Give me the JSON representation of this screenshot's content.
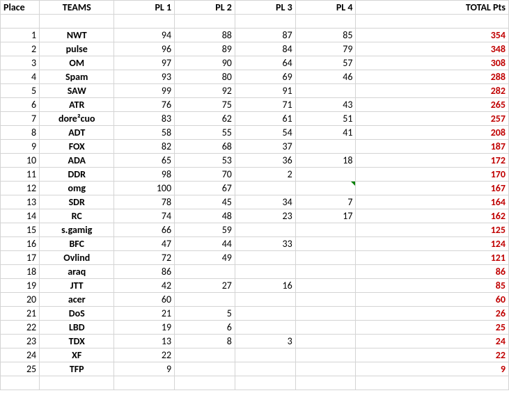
{
  "headers": {
    "place": "Place",
    "teams": "TEAMS",
    "pl1": "PL 1",
    "pl2": "PL 2",
    "pl3": "PL 3",
    "pl4": "PL 4",
    "total": "TOTAL Pts"
  },
  "rows": [
    {
      "place": "1",
      "team": "NWT",
      "pl1": "94",
      "pl2": "88",
      "pl3": "87",
      "pl4": "85",
      "total": "354"
    },
    {
      "place": "2",
      "team": "pulse",
      "pl1": "96",
      "pl2": "89",
      "pl3": "84",
      "pl4": "79",
      "total": "348"
    },
    {
      "place": "3",
      "team": "OM",
      "pl1": "97",
      "pl2": "90",
      "pl3": "64",
      "pl4": "57",
      "total": "308"
    },
    {
      "place": "4",
      "team": "Spam",
      "pl1": "93",
      "pl2": "80",
      "pl3": "69",
      "pl4": "46",
      "total": "288"
    },
    {
      "place": "5",
      "team": "SAW",
      "pl1": "99",
      "pl2": "92",
      "pl3": "91",
      "pl4": "",
      "total": "282"
    },
    {
      "place": "6",
      "team": "ATR",
      "pl1": "76",
      "pl2": "75",
      "pl3": "71",
      "pl4": "43",
      "total": "265"
    },
    {
      "place": "7",
      "team": "dore²cuo",
      "pl1": "83",
      "pl2": "62",
      "pl3": "61",
      "pl4": "51",
      "total": "257"
    },
    {
      "place": "8",
      "team": "ADT",
      "pl1": "58",
      "pl2": "55",
      "pl3": "54",
      "pl4": "41",
      "total": "208"
    },
    {
      "place": "9",
      "team": "FOX",
      "pl1": "82",
      "pl2": "68",
      "pl3": "37",
      "pl4": "",
      "total": "187"
    },
    {
      "place": "10",
      "team": "ADA",
      "pl1": "65",
      "pl2": "53",
      "pl3": "36",
      "pl4": "18",
      "total": "172"
    },
    {
      "place": "11",
      "team": "DDR",
      "pl1": "98",
      "pl2": "70",
      "pl3": "2",
      "pl4": "",
      "total": "170"
    },
    {
      "place": "12",
      "team": "omg",
      "pl1": "100",
      "pl2": "67",
      "pl3": "",
      "pl4": "",
      "total": "167",
      "pl4_flag": true
    },
    {
      "place": "13",
      "team": "SDR",
      "pl1": "78",
      "pl2": "45",
      "pl3": "34",
      "pl4": "7",
      "total": "164"
    },
    {
      "place": "14",
      "team": "RC",
      "pl1": "74",
      "pl2": "48",
      "pl3": "23",
      "pl4": "17",
      "total": "162"
    },
    {
      "place": "15",
      "team": "s.gamig",
      "pl1": "66",
      "pl2": "59",
      "pl3": "",
      "pl4": "",
      "total": "125"
    },
    {
      "place": "16",
      "team": "BFC",
      "pl1": "47",
      "pl2": "44",
      "pl3": "33",
      "pl4": "",
      "total": "124"
    },
    {
      "place": "17",
      "team": "Ovlind",
      "pl1": "72",
      "pl2": "49",
      "pl3": "",
      "pl4": "",
      "total": "121"
    },
    {
      "place": "18",
      "team": "araq",
      "pl1": "86",
      "pl2": "",
      "pl3": "",
      "pl4": "",
      "total": "86"
    },
    {
      "place": "19",
      "team": "JTT",
      "pl1": "42",
      "pl2": "27",
      "pl3": "16",
      "pl4": "",
      "total": "85"
    },
    {
      "place": "20",
      "team": "acer",
      "pl1": "60",
      "pl2": "",
      "pl3": "",
      "pl4": "",
      "total": "60"
    },
    {
      "place": "21",
      "team": "DoS",
      "pl1": "21",
      "pl2": "5",
      "pl3": "",
      "pl4": "",
      "total": "26"
    },
    {
      "place": "22",
      "team": "LBD",
      "pl1": "19",
      "pl2": "6",
      "pl3": "",
      "pl4": "",
      "total": "25"
    },
    {
      "place": "23",
      "team": "TDX",
      "pl1": "13",
      "pl2": "8",
      "pl3": "3",
      "pl4": "",
      "total": "24"
    },
    {
      "place": "24",
      "team": "XF",
      "pl1": "22",
      "pl2": "",
      "pl3": "",
      "pl4": "",
      "total": "22"
    },
    {
      "place": "25",
      "team": "TFP",
      "pl1": "9",
      "pl2": "",
      "pl3": "",
      "pl4": "",
      "total": "9"
    }
  ]
}
